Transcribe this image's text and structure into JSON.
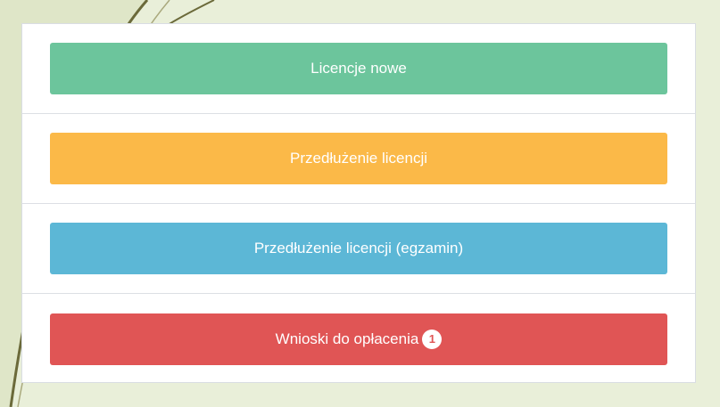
{
  "buttons": {
    "new_licenses": "Licencje nowe",
    "license_extension": "Przedłużenie licencji",
    "license_extension_exam": "Przedłużenie licencji (egzamin)",
    "requests_to_pay": "Wnioski do opłacenia",
    "requests_to_pay_count": "1"
  },
  "colors": {
    "green": "#6cc59c",
    "orange": "#fbb948",
    "blue": "#5cb7d6",
    "red": "#e05555"
  }
}
